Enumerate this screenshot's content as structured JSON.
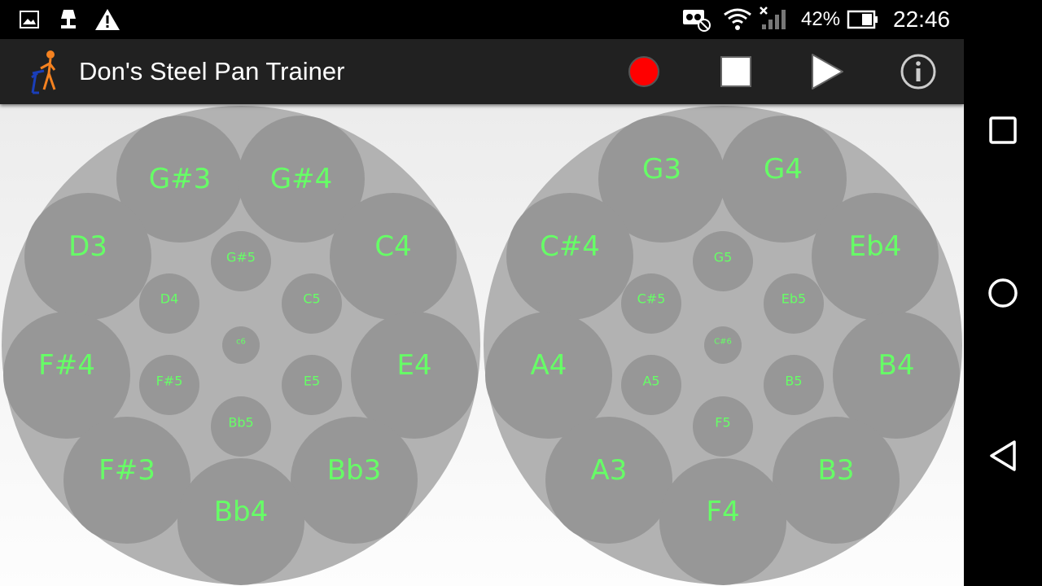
{
  "status_bar": {
    "battery": "42%",
    "time": "22:46",
    "left_icons": [
      "image-icon",
      "lamp-icon",
      "warning-icon"
    ],
    "right_icons": [
      "cast-blocked-icon",
      "wifi-icon",
      "no-signal-icon",
      "battery-icon"
    ]
  },
  "app_bar": {
    "title": "Don's Steel Pan Trainer",
    "actions": [
      "record",
      "stop",
      "play",
      "info"
    ]
  },
  "colors": {
    "drum_outer": "#b2b2b2",
    "note_pad": "#979797",
    "note_text": "#66ff66",
    "record": "#ff0000"
  },
  "left_pan": {
    "outer_notes": [
      "G#3",
      "G#4",
      "D3",
      "C4",
      "F#4",
      "E4",
      "F#3",
      "Bb3",
      "Bb4"
    ],
    "inner_notes": [
      "G#5",
      "D4",
      "C5",
      "F#5",
      "E5",
      "Bb5"
    ],
    "center_note": "c6"
  },
  "right_pan": {
    "outer_notes": [
      "G3",
      "G4",
      "C#4",
      "Eb4",
      "A4",
      "B4",
      "A3",
      "B3",
      "F4"
    ],
    "inner_notes": [
      "G5",
      "C#5",
      "Eb5",
      "A5",
      "B5",
      "F5"
    ],
    "center_note": "C#6"
  },
  "nav_bar": [
    "recents",
    "home",
    "back"
  ]
}
